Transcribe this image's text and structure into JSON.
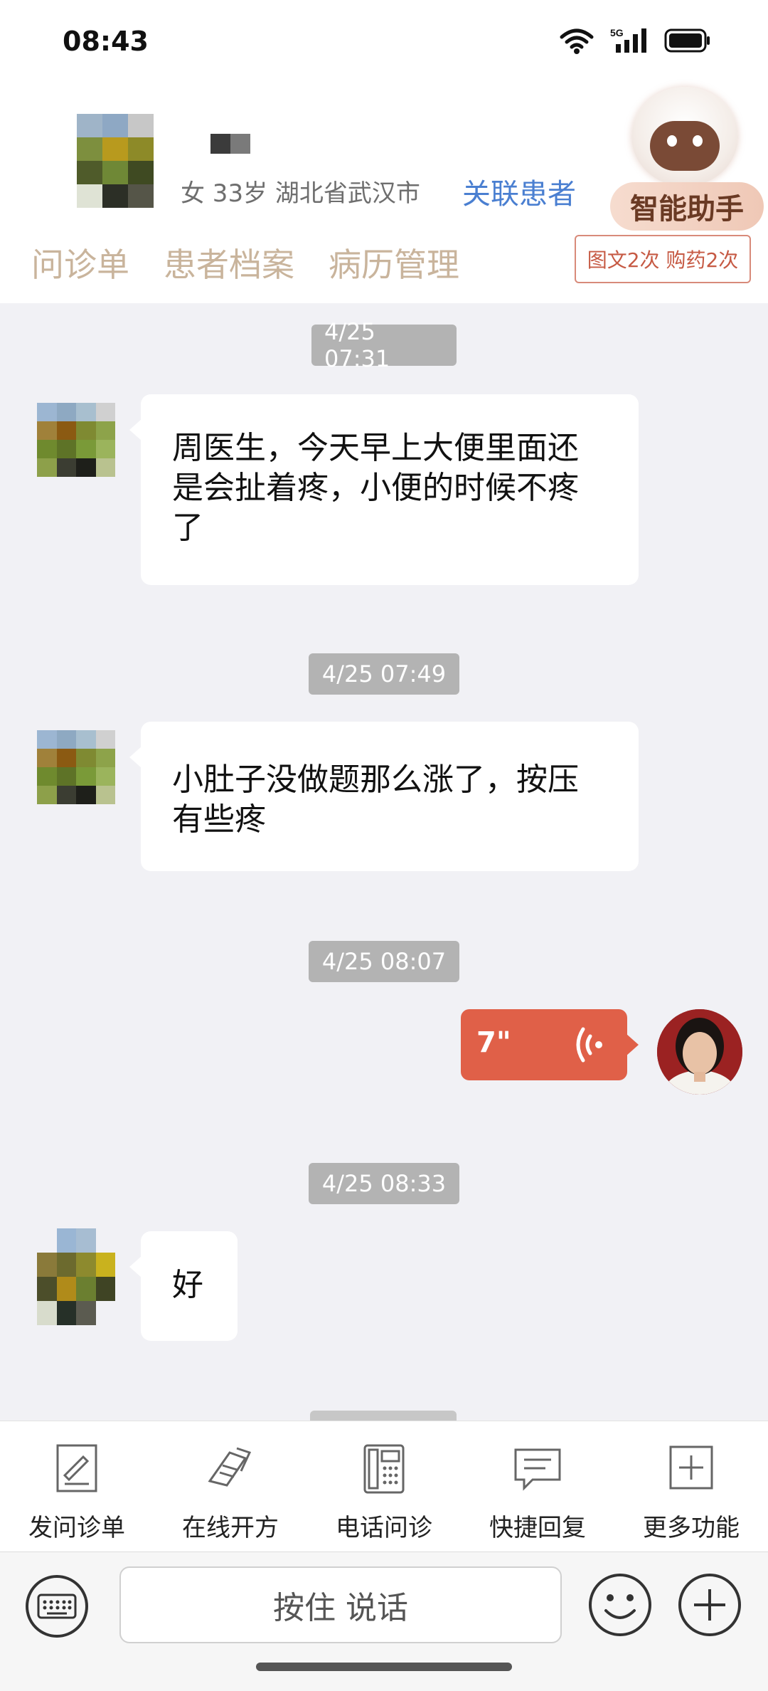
{
  "status_bar": {
    "time": "08:43",
    "network": "5G"
  },
  "header": {
    "patient_info": "女 33岁  湖北省武汉市",
    "link_patient": "关联患者",
    "assistant_label": "智能助手",
    "tabs": [
      "问诊单",
      "患者档案",
      "病历管理"
    ],
    "quota": "图文2次 购药2次"
  },
  "messages": [
    {
      "time": "4/25 07:31",
      "sender": "patient",
      "lines": [
        "周医生，今天早上大便里面还",
        "是会扯着疼，小便的时候不疼",
        "了"
      ]
    },
    {
      "time": "4/25 07:49",
      "sender": "patient",
      "lines": [
        "小肚子没做题那么涨了，按压",
        "有些疼"
      ]
    },
    {
      "time": "4/25 08:07",
      "sender": "doctor",
      "type": "voice",
      "duration": "7\""
    },
    {
      "time": "4/25 08:33",
      "sender": "patient",
      "lines": [
        "好"
      ]
    }
  ],
  "toolbar": {
    "items": [
      {
        "label": "发问诊单",
        "icon": "form-icon"
      },
      {
        "label": "在线开方",
        "icon": "prescription-icon"
      },
      {
        "label": "电话问诊",
        "icon": "phone-icon"
      },
      {
        "label": "快捷回复",
        "icon": "quick-reply-icon"
      },
      {
        "label": "更多功能",
        "icon": "more-icon"
      }
    ]
  },
  "input": {
    "hold_to_talk": "按住 说话"
  },
  "colors": {
    "accent_link": "#4a7fd1",
    "voice_bubble": "#e06048",
    "tab_text": "#c9b49c"
  }
}
